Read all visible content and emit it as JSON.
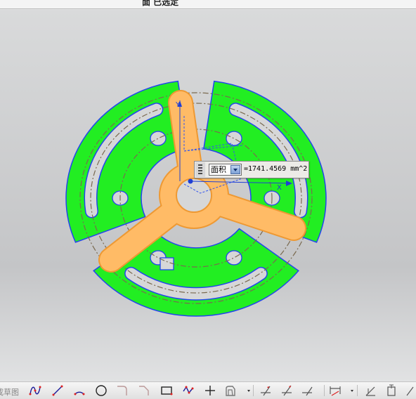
{
  "status_bar": {
    "message": "面 已选定"
  },
  "part": {
    "face_color": "#22ee22",
    "edge_color": "#2244ee",
    "selected_color": "#ffbb66",
    "selected_edge_color": "#ee9933",
    "centerline_color": "#7a6a50"
  },
  "triad": {
    "y_label": "Y",
    "x_label": "X"
  },
  "measure": {
    "type": "面积",
    "value": "=1741.4569 mm^2"
  },
  "toolbar": {
    "label": "成草图",
    "tools": [
      "studio-spline-icon",
      "line-icon",
      "arc-icon",
      "circle-icon",
      "fillet-icon",
      "chamfer-icon",
      "rectangle-icon",
      "polygon-icon",
      "point-icon",
      "offset-curve-icon",
      "quick-trim-icon",
      "quick-extend-icon",
      "make-corner-icon",
      "dimension-icon",
      "constraint-icon",
      "display-constraints-icon"
    ]
  }
}
